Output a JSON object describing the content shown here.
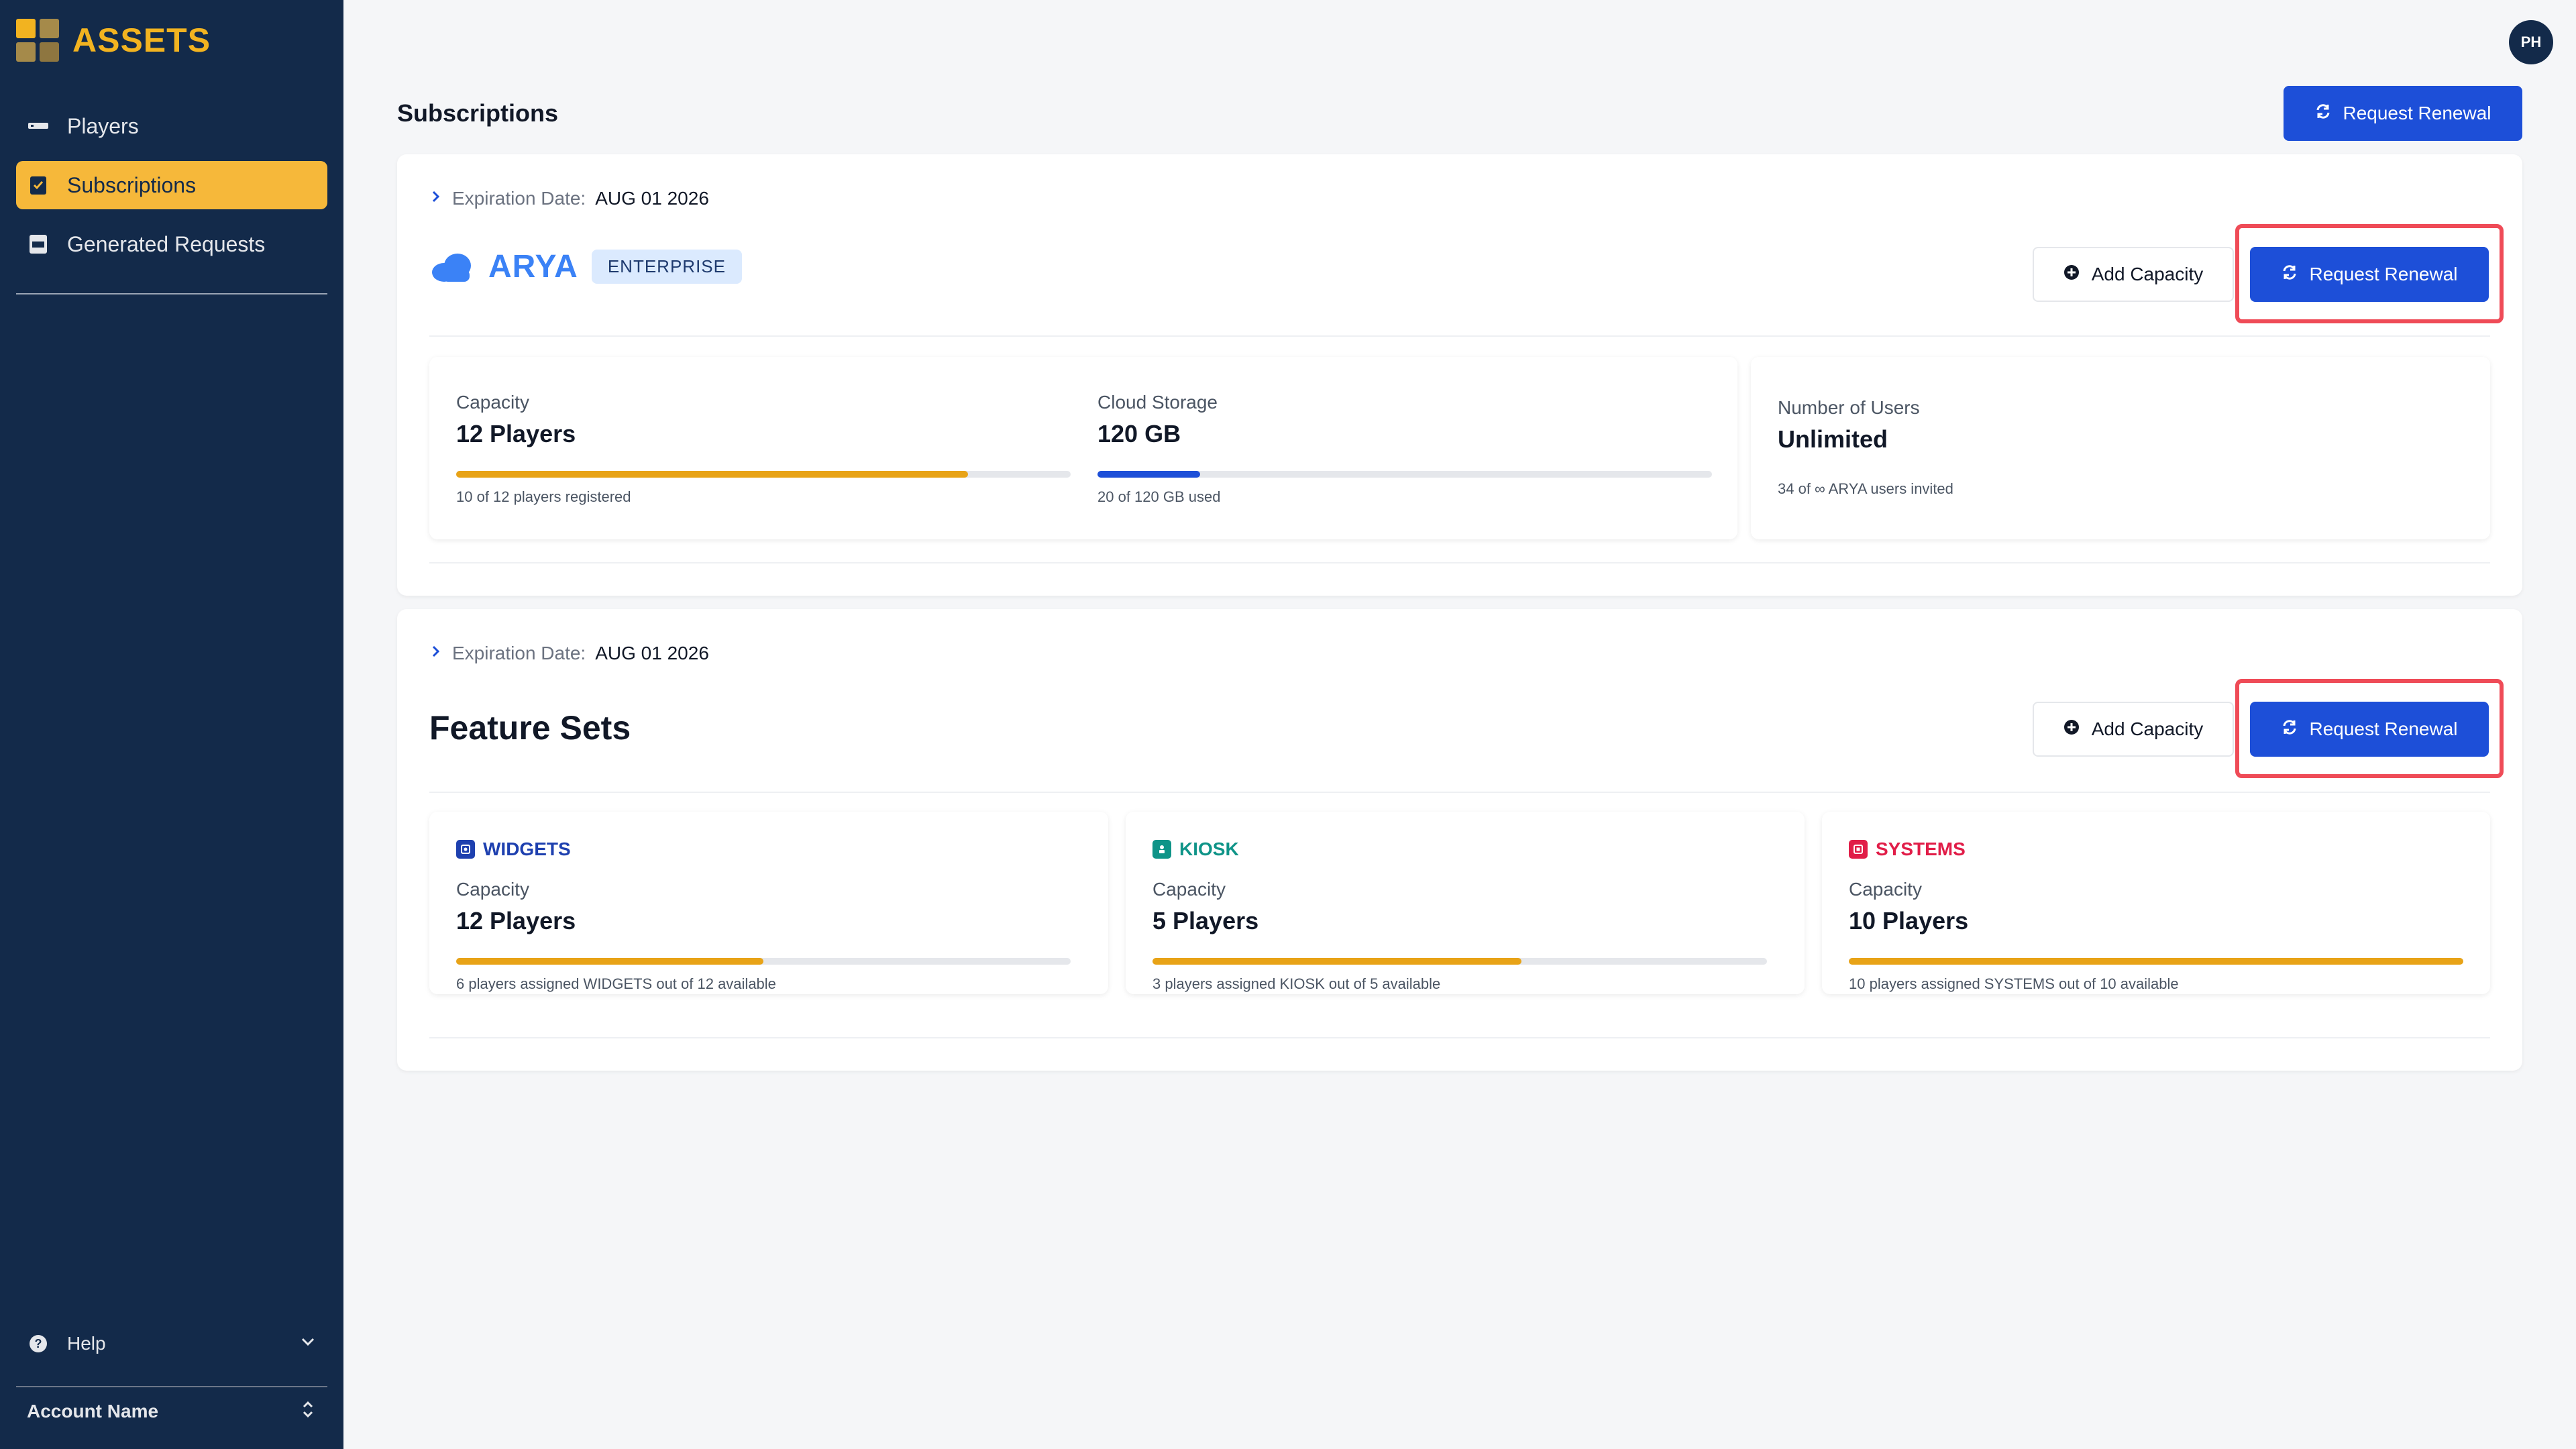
{
  "app": {
    "name": "ASSETS"
  },
  "sidebar": {
    "items": [
      {
        "label": "Players",
        "icon": "player-device-icon"
      },
      {
        "label": "Subscriptions",
        "icon": "subscription-clipboard-icon",
        "active": true
      },
      {
        "label": "Generated Requests",
        "icon": "pdf-document-icon"
      }
    ],
    "help_label": "Help",
    "account_label": "Account Name"
  },
  "header": {
    "avatar_initials": "PH",
    "page_title": "Subscriptions",
    "renew_label": "Request Renewal"
  },
  "subscription": {
    "expiration_label": "Expiration Date:",
    "expiration_value": "AUG 01 2026",
    "name": "ARYA",
    "tier": "ENTERPRISE",
    "add_capacity_label": "Add Capacity",
    "renew_label": "Request Renewal",
    "metrics": {
      "capacity": {
        "label": "Capacity",
        "value": "12 Players",
        "used": 10,
        "total": 12,
        "foot": "10 of 12 players registered",
        "color": "#e8a317"
      },
      "storage": {
        "label": "Cloud Storage",
        "value": "120 GB",
        "used": 20,
        "total": 120,
        "foot": "20 of 120 GB used",
        "color": "#1d4fd8"
      },
      "users": {
        "label": "Number of Users",
        "value": "Unlimited",
        "foot": "34 of ∞ ARYA users invited"
      }
    }
  },
  "feature_sets": {
    "expiration_label": "Expiration Date:",
    "expiration_value": "AUG 01 2026",
    "title": "Feature Sets",
    "add_capacity_label": "Add Capacity",
    "renew_label": "Request Renewal",
    "items": [
      {
        "name": "WIDGETS",
        "color": "#1e40af",
        "capacity_label": "Capacity",
        "value": "12 Players",
        "assigned": 6,
        "total": 12,
        "foot": "6 players assigned WIDGETS out of 12 available",
        "bar_color": "#e8a317"
      },
      {
        "name": "KIOSK",
        "color": "#0f9488",
        "capacity_label": "Capacity",
        "value": "5 Players",
        "assigned": 3,
        "total": 5,
        "foot": "3 players assigned KIOSK out of 5 available",
        "bar_color": "#e8a317"
      },
      {
        "name": "SYSTEMS",
        "color": "#e11d48",
        "capacity_label": "Capacity",
        "value": "10 Players",
        "assigned": 10,
        "total": 10,
        "foot": "10 players assigned SYSTEMS out of 10 available",
        "bar_color": "#e8a317"
      }
    ]
  },
  "colors": {
    "sidebar_bg": "#132a4a",
    "brand": "#f2b320",
    "active_nav": "#f6b83a",
    "primary": "#1d4fd8",
    "highlight": "#ef4b57"
  }
}
